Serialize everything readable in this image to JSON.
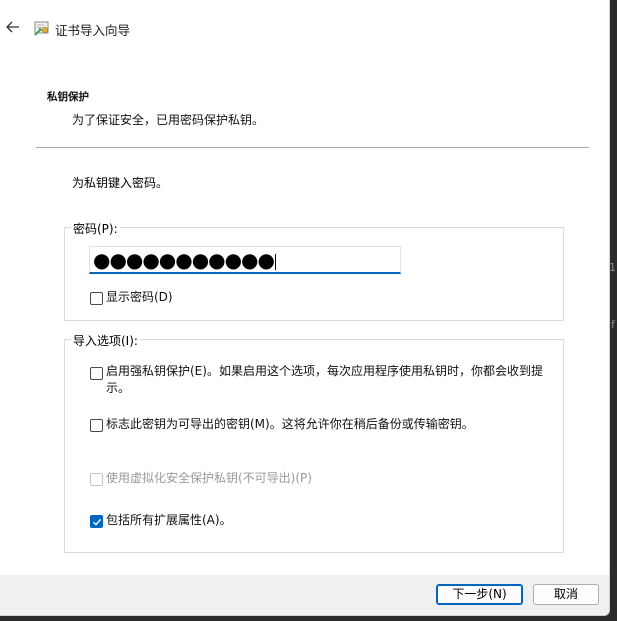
{
  "window": {
    "title": "证书导入向导",
    "back_icon": "arrow-left-icon",
    "app_icon": "certificate-icon"
  },
  "section": {
    "heading": "私钥保护",
    "description": "为了保证安全，已用密码保护私钥。"
  },
  "instruction": "为私钥键入密码。",
  "password_group": {
    "label": "密码(P):",
    "value": "●●●●●●●●●●●",
    "show_password": {
      "label": "显示密码(D)",
      "checked": false
    }
  },
  "import_options": {
    "label": "导入选项(I):",
    "options": [
      {
        "label_line1": "启用强私钥保护(E)。如果启用这个选项，每次应用程序使用私钥时，你都会收到提",
        "label_line2": "示。",
        "checked": false,
        "enabled": true
      },
      {
        "label_line1": "标志此密钥为可导出的密钥(M)。这将允许你在稍后备份或传输密钥。",
        "checked": false,
        "enabled": true
      },
      {
        "label_line1": "使用虚拟化安全保护私钥(不可导出)(P)",
        "checked": false,
        "enabled": false
      },
      {
        "label_line1": "包括所有扩展属性(A)。",
        "checked": true,
        "enabled": true
      }
    ]
  },
  "buttons": {
    "next": "下一步(N)",
    "cancel": "取消"
  },
  "accent_color": "#0067c0",
  "background_fragments": [
    "1(",
    "f"
  ]
}
